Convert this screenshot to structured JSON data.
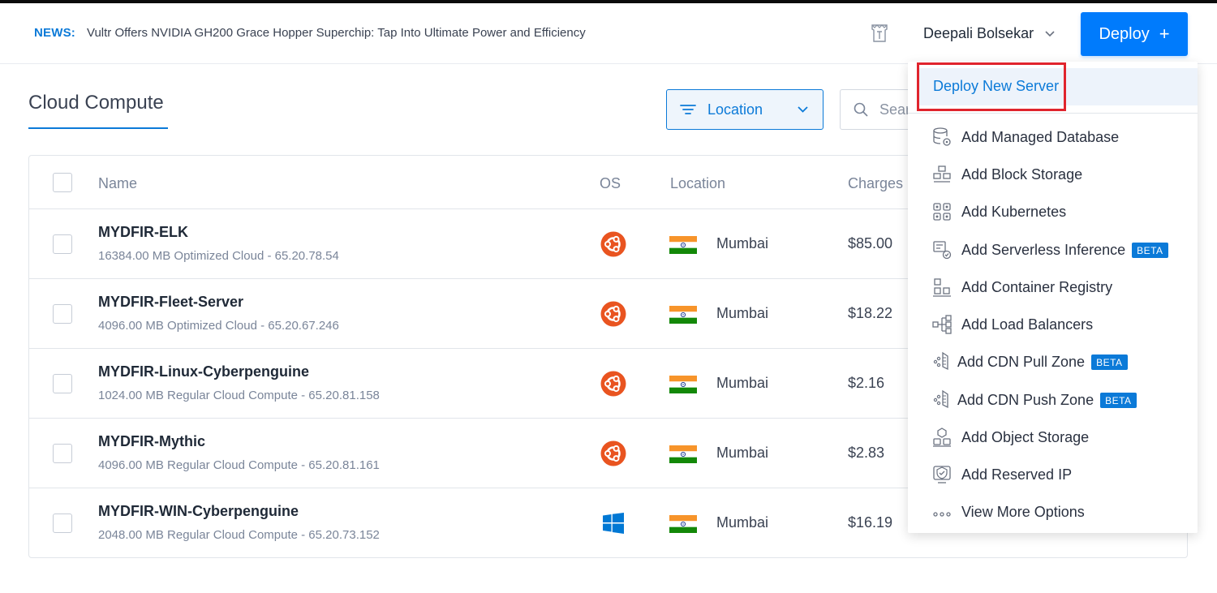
{
  "header": {
    "news_label": "NEWS:",
    "news_text": "Vultr Offers NVIDIA GH200 Grace Hopper Superchip: Tap Into Ultimate Power and Efficiency",
    "user_name": "Deepali Bolsekar",
    "deploy_label": "Deploy",
    "deploy_icon": "+"
  },
  "page": {
    "title": "Cloud Compute",
    "location_filter": "Location",
    "search_placeholder": "Search"
  },
  "table": {
    "columns": {
      "name": "Name",
      "os": "OS",
      "location": "Location",
      "charges": "Charges"
    },
    "rows": [
      {
        "name": "MYDFIR-ELK",
        "details": "16384.00 MB Optimized Cloud - 65.20.78.54",
        "os": "ubuntu",
        "location": "Mumbai",
        "charges": "$85.00"
      },
      {
        "name": "MYDFIR-Fleet-Server",
        "details": "4096.00 MB Optimized Cloud - 65.20.67.246",
        "os": "ubuntu",
        "location": "Mumbai",
        "charges": "$18.22"
      },
      {
        "name": "MYDFIR-Linux-Cyberpenguine",
        "details": "1024.00 MB Regular Cloud Compute - 65.20.81.158",
        "os": "ubuntu",
        "location": "Mumbai",
        "charges": "$2.16"
      },
      {
        "name": "MYDFIR-Mythic",
        "details": "4096.00 MB Regular Cloud Compute - 65.20.81.161",
        "os": "ubuntu",
        "location": "Mumbai",
        "charges": "$2.83"
      },
      {
        "name": "MYDFIR-WIN-Cyberpenguine",
        "details": "2048.00 MB Regular Cloud Compute - 65.20.73.152",
        "os": "windows",
        "location": "Mumbai",
        "charges": "$16.19"
      }
    ]
  },
  "deploy_menu": {
    "primary": "Deploy New Server",
    "items": [
      {
        "label": "Add Managed Database",
        "icon": "database-icon"
      },
      {
        "label": "Add Block Storage",
        "icon": "block-storage-icon"
      },
      {
        "label": "Add Kubernetes",
        "icon": "kubernetes-icon"
      },
      {
        "label": "Add Serverless Inference",
        "icon": "serverless-icon",
        "badge": "BETA"
      },
      {
        "label": "Add Container Registry",
        "icon": "container-registry-icon"
      },
      {
        "label": "Add Load Balancers",
        "icon": "load-balancer-icon"
      },
      {
        "label": "Add CDN Pull Zone",
        "icon": "cdn-icon",
        "badge": "BETA"
      },
      {
        "label": "Add CDN Push Zone",
        "icon": "cdn-icon",
        "badge": "BETA"
      },
      {
        "label": "Add Object Storage",
        "icon": "object-storage-icon"
      },
      {
        "label": "Add Reserved IP",
        "icon": "reserved-ip-icon"
      },
      {
        "label": "View More Options",
        "icon": "more-icon"
      }
    ]
  },
  "colors": {
    "accent": "#007bfc",
    "link": "#0b7ad8",
    "ubuntu": "#e95420",
    "windows": "#0078d4",
    "highlight": "#e0242d"
  }
}
